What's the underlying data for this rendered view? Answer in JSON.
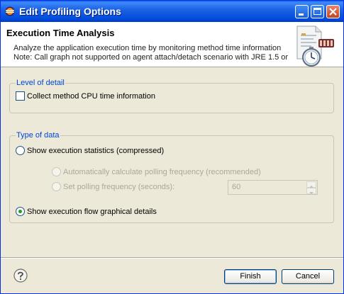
{
  "window": {
    "title": "Edit Profiling Options"
  },
  "header": {
    "title": "Execution Time Analysis",
    "description_line1": "Analyze the application execution time by monitoring method time information",
    "description_line2": "Note: Call graph not supported on agent attach/detach scenario with JRE 1.5 or",
    "icon": "profiling-stopwatch-icon"
  },
  "level_of_detail": {
    "legend": "Level of detail",
    "cpu_time_label": "Collect method CPU time information",
    "cpu_time_checked": false
  },
  "type_of_data": {
    "legend": "Type of data",
    "statistics_label": "Show execution statistics (compressed)",
    "statistics_selected": false,
    "auto_polling_label": "Automatically calculate polling frequency (recommended)",
    "set_polling_label": "Set polling frequency (seconds):",
    "polling_value": "60",
    "flow_label": "Show execution flow graphical details",
    "flow_selected": true
  },
  "buttons": {
    "finish": "Finish",
    "cancel": "Cancel",
    "help_icon": "help-icon"
  },
  "colors": {
    "titlebar": "#0054e3",
    "legend_text": "#0046d5",
    "dialog_bg": "#ece9d8",
    "disabled_text": "#aca899"
  }
}
